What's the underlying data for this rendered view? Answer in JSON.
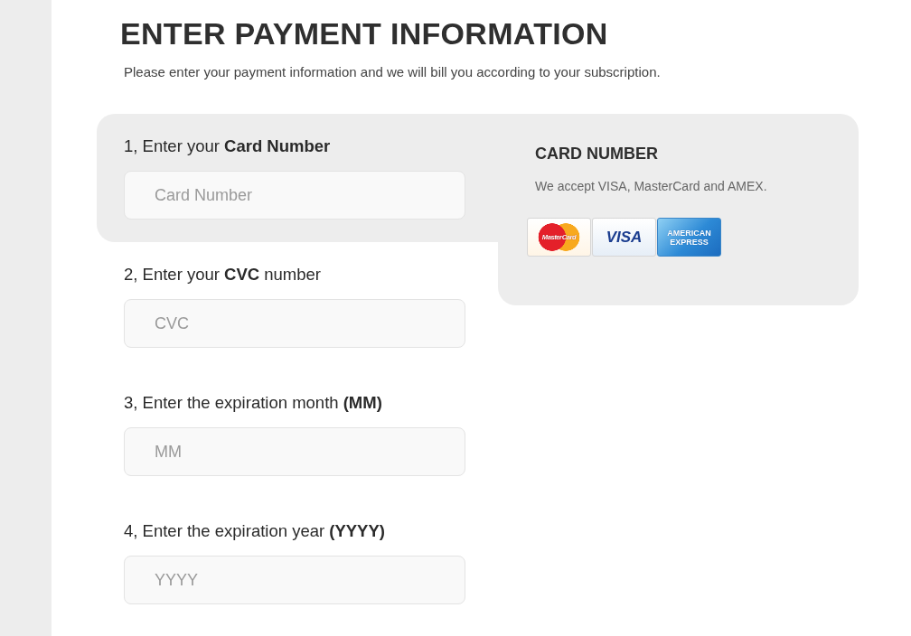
{
  "header": {
    "title": "ENTER PAYMENT INFORMATION",
    "subtitle": "Please enter your payment information and we will bill you according to your subscription."
  },
  "steps": [
    {
      "label": "1, Enter your **Card Number**",
      "placeholder": "Card Number",
      "highlighted": true
    },
    {
      "label": "2, Enter your **CVC** number",
      "placeholder": "CVC",
      "highlighted": false
    },
    {
      "label": "3, Enter the expiration month **(MM)**",
      "placeholder": "MM",
      "highlighted": false
    },
    {
      "label": "4, Enter the expiration year **(YYYY)**",
      "placeholder": "YYYY",
      "highlighted": false
    }
  ],
  "info_panel": {
    "title": "CARD NUMBER",
    "text": "We accept VISA, MasterCard and AMEX.",
    "cards": [
      {
        "kind": "mastercard",
        "text": "MasterCard"
      },
      {
        "kind": "visa",
        "text": "VISA"
      },
      {
        "kind": "amex",
        "text": "AMERICAN EXPRESS"
      }
    ]
  }
}
